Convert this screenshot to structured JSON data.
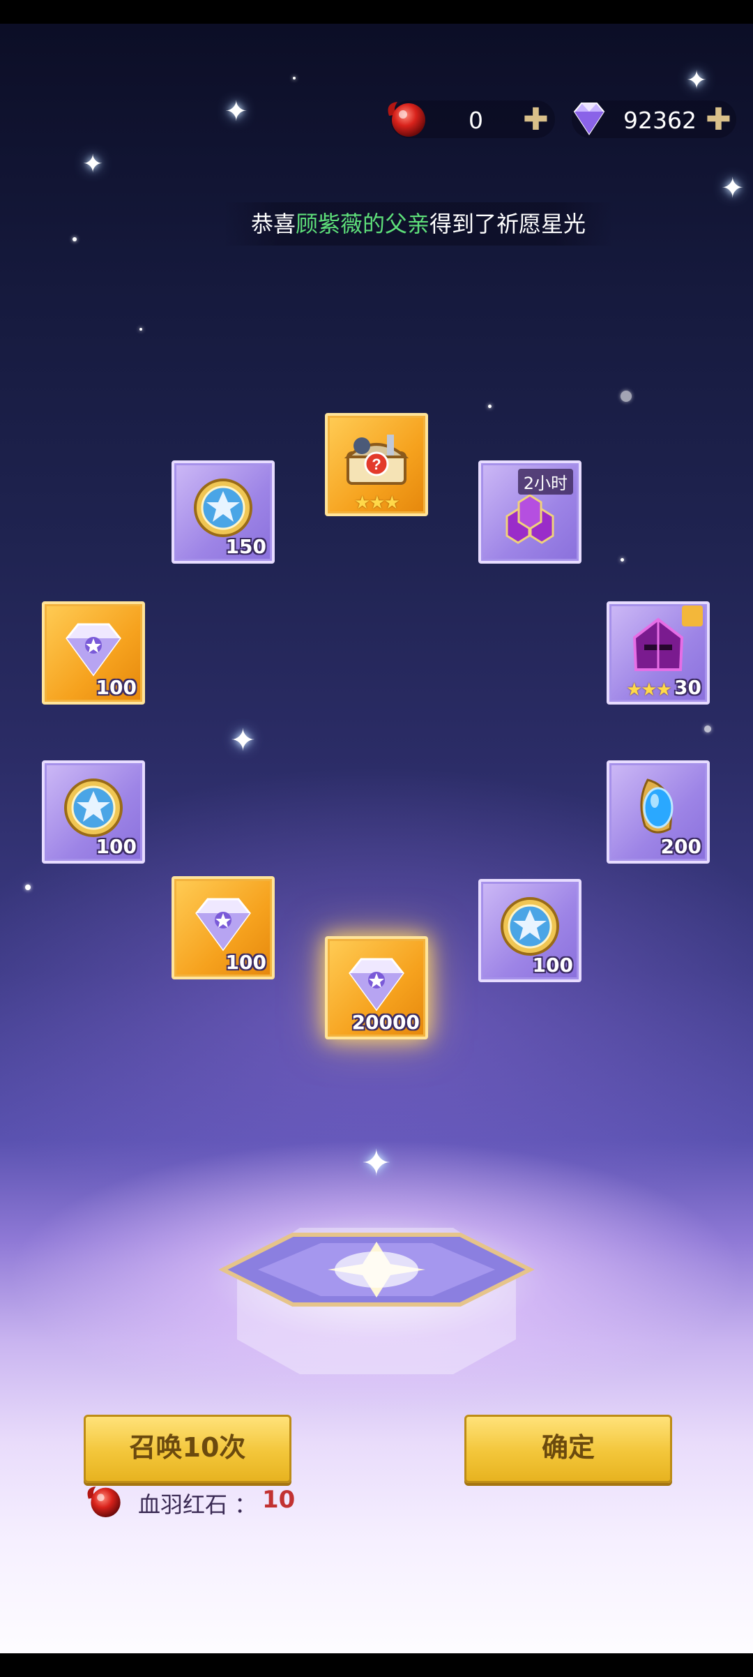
{
  "currency": {
    "ruby": {
      "value": "0",
      "icon": "red-orb-icon"
    },
    "diamond": {
      "value": "92362",
      "icon": "purple-diamond-icon"
    }
  },
  "announcement": {
    "prefix": "恭喜",
    "player": "顾紫薇的父亲",
    "suffix": "得到了祈愿星光"
  },
  "rewards": [
    {
      "icon": "mystery-chest-icon",
      "qty": "",
      "stars": 3,
      "frame": "orange"
    },
    {
      "icon": "star-medal-icon",
      "qty": "150",
      "frame": "purple"
    },
    {
      "icon": "potion-bundle-icon",
      "qty": "",
      "tag": "2小时",
      "frame": "purple"
    },
    {
      "icon": "diamond-icon",
      "qty": "100",
      "frame": "orange"
    },
    {
      "icon": "hero-helmet-icon",
      "qty": "30",
      "stars": 3,
      "frame": "purple"
    },
    {
      "icon": "star-medal-icon",
      "qty": "100",
      "frame": "purple"
    },
    {
      "icon": "blue-gem-icon",
      "qty": "200",
      "frame": "purple"
    },
    {
      "icon": "diamond-icon",
      "qty": "100",
      "frame": "orange"
    },
    {
      "icon": "star-medal-icon",
      "qty": "100",
      "frame": "purple"
    },
    {
      "icon": "diamond-icon",
      "qty": "20000",
      "frame": "orange"
    }
  ],
  "buttons": {
    "summon": "召唤10次",
    "confirm": "确定"
  },
  "cost": {
    "label": "血羽红石 ：",
    "value": "10"
  },
  "colors": {
    "accent_gold": "#f3c63a",
    "highlight_green": "#5ee07a",
    "cost_red": "#c23232"
  }
}
